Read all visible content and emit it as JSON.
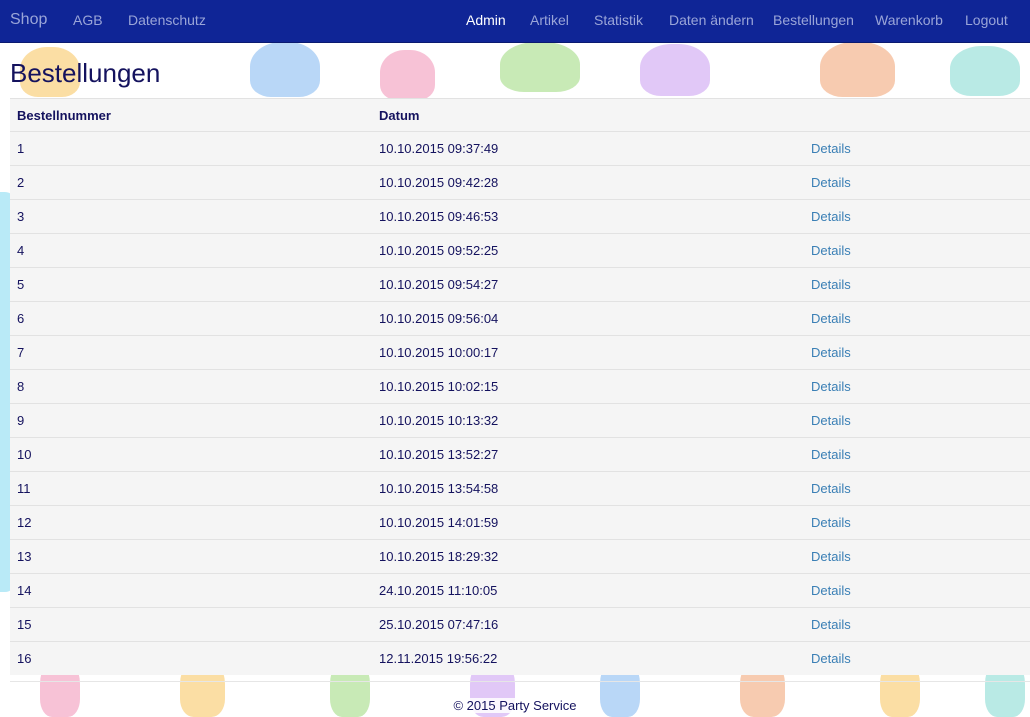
{
  "nav": {
    "brand": "Shop",
    "left_links": [
      "AGB",
      "Datenschutz"
    ],
    "right_links": [
      "Admin",
      "Artikel",
      "Statistik",
      "Daten ändern",
      "Bestellungen",
      "Warenkorb",
      "Logout"
    ],
    "active": "Admin"
  },
  "page": {
    "title": "Bestellungen"
  },
  "table": {
    "headers": [
      "Bestellnummer",
      "Datum",
      ""
    ],
    "details_label": "Details",
    "rows": [
      {
        "id": "1",
        "date": "10.10.2015 09:37:49"
      },
      {
        "id": "2",
        "date": "10.10.2015 09:42:28"
      },
      {
        "id": "3",
        "date": "10.10.2015 09:46:53"
      },
      {
        "id": "4",
        "date": "10.10.2015 09:52:25"
      },
      {
        "id": "5",
        "date": "10.10.2015 09:54:27"
      },
      {
        "id": "6",
        "date": "10.10.2015 09:56:04"
      },
      {
        "id": "7",
        "date": "10.10.2015 10:00:17"
      },
      {
        "id": "8",
        "date": "10.10.2015 10:02:15"
      },
      {
        "id": "9",
        "date": "10.10.2015 10:13:32"
      },
      {
        "id": "10",
        "date": "10.10.2015 13:52:27"
      },
      {
        "id": "11",
        "date": "10.10.2015 13:54:58"
      },
      {
        "id": "12",
        "date": "10.10.2015 14:01:59"
      },
      {
        "id": "13",
        "date": "10.10.2015 18:29:32"
      },
      {
        "id": "14",
        "date": "24.10.2015 11:10:05"
      },
      {
        "id": "15",
        "date": "25.10.2015 07:47:16"
      },
      {
        "id": "16",
        "date": "12.11.2015 19:56:22"
      }
    ]
  },
  "footer": {
    "text": "© 2015 Party Service"
  },
  "colors": {
    "navbar_bg": "#0f2596",
    "nav_link": "#9aa5d8",
    "nav_active": "#ffffff",
    "text": "#14125e",
    "link": "#3a7fb5",
    "table_bg": "#f5f5f5"
  }
}
